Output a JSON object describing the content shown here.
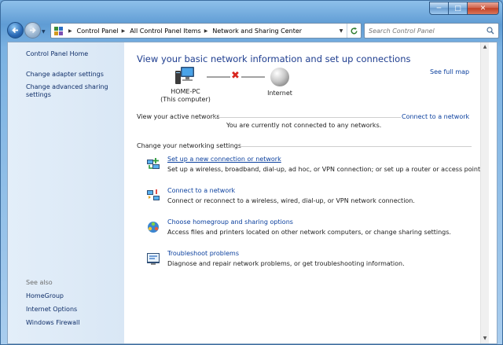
{
  "window": {
    "caption_buttons": {
      "minimize": "─",
      "maximize": "□",
      "close": "✕"
    }
  },
  "nav": {
    "back_icon": "back-arrow-icon",
    "forward_icon": "forward-arrow-icon",
    "breadcrumbs": [
      "Control Panel",
      "All Control Panel Items",
      "Network and Sharing Center"
    ],
    "search_placeholder": "Search Control Panel"
  },
  "sidebar": {
    "home": "Control Panel Home",
    "links": [
      "Change adapter settings",
      "Change advanced sharing settings"
    ],
    "see_also_label": "See also",
    "see_also": [
      "HomeGroup",
      "Internet Options",
      "Windows Firewall"
    ]
  },
  "main": {
    "title": "View your basic network information and set up connections",
    "see_full_map": "See full map",
    "map": {
      "computer_name": "HOME-PC",
      "computer_sub": "(This computer)",
      "internet": "Internet"
    },
    "active_networks_label": "View your active networks",
    "connect_link": "Connect to a network",
    "not_connected": "You are currently not connected to any networks.",
    "change_settings_label": "Change your networking settings",
    "tasks": [
      {
        "title": "Set up a new connection or network",
        "desc": "Set up a wireless, broadband, dial-up, ad hoc, or VPN connection; or set up a router or access point.",
        "icon": "new-connection-icon"
      },
      {
        "title": "Connect to a network",
        "desc": "Connect or reconnect to a wireless, wired, dial-up, or VPN network connection.",
        "icon": "connect-network-icon"
      },
      {
        "title": "Choose homegroup and sharing options",
        "desc": "Access files and printers located on other network computers, or change sharing settings.",
        "icon": "homegroup-icon"
      },
      {
        "title": "Troubleshoot problems",
        "desc": "Diagnose and repair network problems, or get troubleshooting information.",
        "icon": "troubleshoot-icon"
      }
    ]
  },
  "colors": {
    "link": "#0a3f9e",
    "title": "#1e3d8f",
    "sidebar_bg": "#dfebf7",
    "error_x": "#d8261f"
  }
}
